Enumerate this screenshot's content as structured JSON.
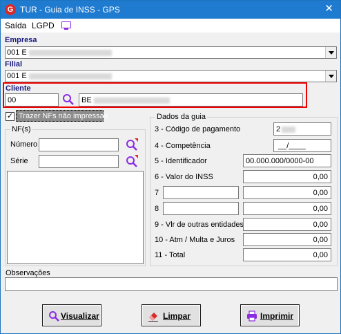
{
  "window": {
    "title": "TUR - Guia de INSS - GPS",
    "app_icon_letter": "G",
    "close_glyph": "✕"
  },
  "menu": {
    "items": [
      "Saída",
      "LGPD"
    ]
  },
  "empresa": {
    "label": "Empresa",
    "value": "001 E"
  },
  "filial": {
    "label": "Filial",
    "value": "001 E"
  },
  "cliente": {
    "label": "Cliente",
    "code": "00",
    "name": "BE"
  },
  "trazer_nfs": {
    "label": "Trazer NFs não impressas",
    "checked": true,
    "check_glyph": "✓"
  },
  "nfs": {
    "legend": "NF(s)",
    "numero_label": "Número",
    "serie_label": "Série"
  },
  "dados_guia": {
    "legend": "Dados da guia",
    "rows": [
      {
        "label": "3 - Código de pagamento",
        "value": "2"
      },
      {
        "label": "4 - Competência",
        "value": "__/____"
      },
      {
        "label": "5 - Identificador",
        "value": "00.000.000/0000-00"
      },
      {
        "label": "6 - Valor do INSS",
        "value": "0,00"
      },
      {
        "label": "7",
        "value": "0,00"
      },
      {
        "label": "8",
        "value": "0,00"
      },
      {
        "label": "9 - Vlr de outras entidades",
        "value": "0,00"
      },
      {
        "label": "10 - Atm / Multa e Juros",
        "value": "0,00"
      },
      {
        "label": "11 - Total",
        "value": "0,00"
      }
    ]
  },
  "observacoes": {
    "label": "Observações",
    "value": ""
  },
  "buttons": {
    "visualizar": "Visualizar",
    "limpar": "Limpar",
    "imprimir": "Imprimir"
  },
  "colors": {
    "titlebar": "#1f7bd0",
    "highlight": "#ee0000",
    "label_blue": "#1a1a80",
    "icon_purple": "#8a2be2"
  }
}
